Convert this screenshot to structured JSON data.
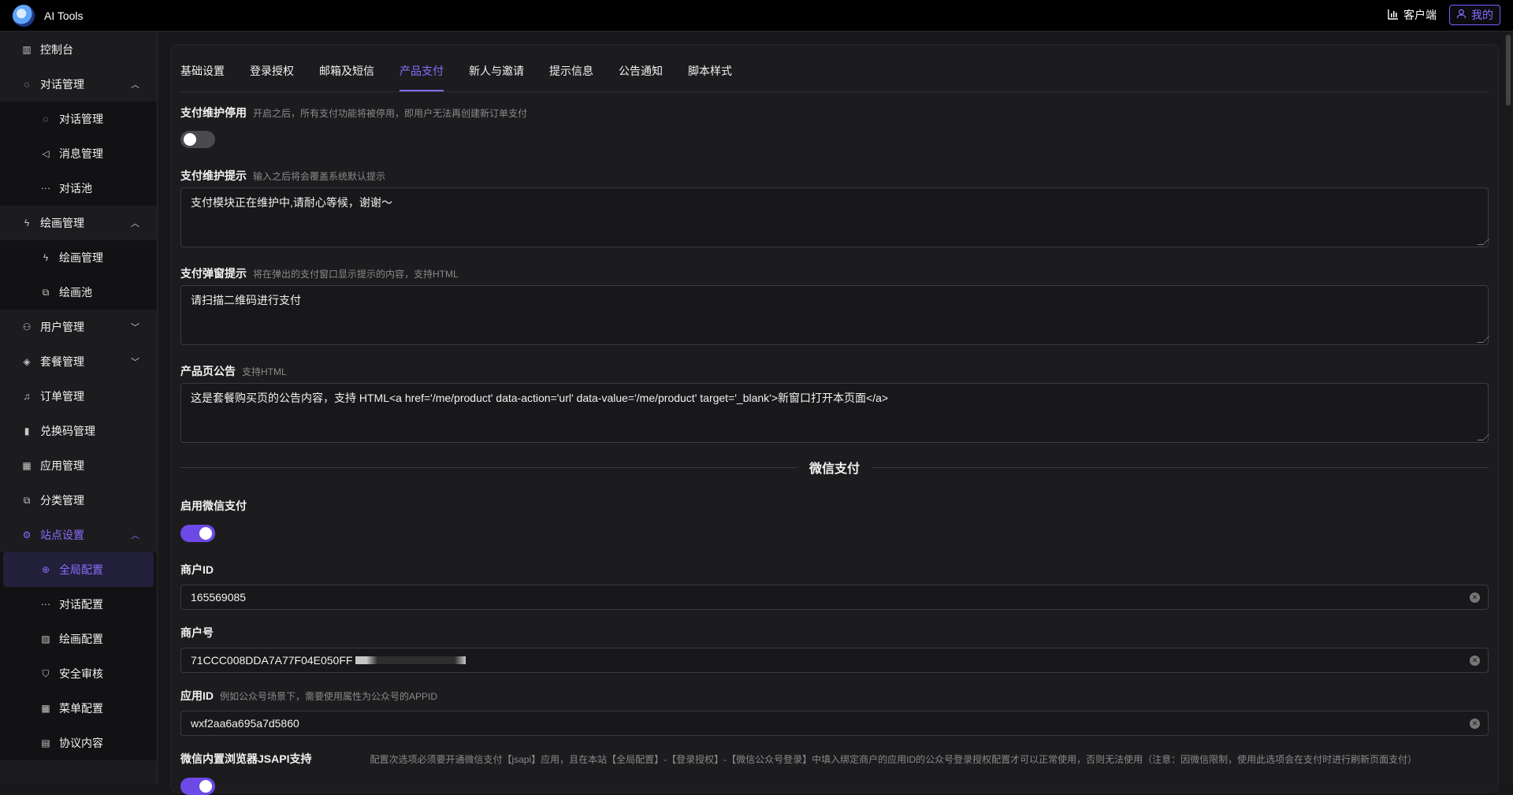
{
  "header": {
    "app_title": "AI Tools",
    "client_label": "客户端",
    "mine_label": "我的"
  },
  "sidebar": {
    "items": [
      {
        "label": "控制台",
        "icon": "chart-icon"
      },
      {
        "label": "对话管理",
        "icon": "chat-icon",
        "expanded": true,
        "children": [
          {
            "label": "对话管理",
            "icon": "chat-icon"
          },
          {
            "label": "消息管理",
            "icon": "megaphone-icon"
          },
          {
            "label": "对话池",
            "icon": "dots-icon"
          }
        ]
      },
      {
        "label": "绘画管理",
        "icon": "bolt-icon",
        "expanded": true,
        "children": [
          {
            "label": "绘画管理",
            "icon": "bolt-icon"
          },
          {
            "label": "绘画池",
            "icon": "copy-icon"
          }
        ]
      },
      {
        "label": "用户管理",
        "icon": "user-icon",
        "expanded": false
      },
      {
        "label": "套餐管理",
        "icon": "diamond-icon",
        "expanded": false
      },
      {
        "label": "订单管理",
        "icon": "bell-icon"
      },
      {
        "label": "兑换码管理",
        "icon": "barcode-icon"
      },
      {
        "label": "应用管理",
        "icon": "grid-icon"
      },
      {
        "label": "分类管理",
        "icon": "copy-icon"
      },
      {
        "label": "站点设置",
        "icon": "gear-icon",
        "expanded": true,
        "children": [
          {
            "label": "全局配置",
            "icon": "globe-icon",
            "active": true
          },
          {
            "label": "对话配置",
            "icon": "dots-icon"
          },
          {
            "label": "绘画配置",
            "icon": "image-icon"
          },
          {
            "label": "安全审核",
            "icon": "shield-icon"
          },
          {
            "label": "菜单配置",
            "icon": "grid-icon"
          },
          {
            "label": "协议内容",
            "icon": "doc-icon"
          }
        ]
      }
    ]
  },
  "tabs": [
    "基础设置",
    "登录授权",
    "邮箱及短信",
    "产品支付",
    "新人与邀请",
    "提示信息",
    "公告通知",
    "脚本样式"
  ],
  "active_tab": "产品支付",
  "form": {
    "maintenance": {
      "label": "支付维护停用",
      "hint": "开启之后，所有支付功能将被停用，即用户无法再创建新订单支付",
      "enabled": false
    },
    "maintenance_tip": {
      "label": "支付维护提示",
      "hint": "输入之后将会覆盖系统默认提示",
      "value": "支付模块正在维护中,请耐心等候，谢谢～"
    },
    "popup_tip": {
      "label": "支付弹窗提示",
      "hint": "将在弹出的支付窗口显示提示的内容，支持HTML",
      "value": "请扫描二维码进行支付"
    },
    "product_notice": {
      "label": "产品页公告",
      "hint": "支持HTML",
      "value": "这是套餐购买页的公告内容，支持 HTML<a href='/me/product' data-action='url' data-value='/me/product' target='_blank'>新窗口打开本页面</a>"
    },
    "wechat_section_title": "微信支付",
    "wechat_enable": {
      "label": "启用微信支付",
      "enabled": true
    },
    "merchant_id": {
      "label": "商户ID",
      "value": "165569085"
    },
    "merchant_key": {
      "label": "商户号",
      "value": "71CCC008DDA7A77F04E050FF"
    },
    "app_id": {
      "label": "应用ID",
      "hint": "例如公众号场景下，需要使用属性为公众号的APPID",
      "value": "wxf2aa6a695a7d5860"
    },
    "jsapi": {
      "label": "微信内置浏览器JSAPI支持",
      "hint": "配置次选项必须要开通微信支付【jsapi】应用，且在本站【全局配置】-【登录授权】-【微信公众号登录】中填入绑定商户的应用ID的公众号登录授权配置才可以正常使用，否则无法使用（注意：因微信限制，使用此选项会在支付时进行刷新页面支付）",
      "enabled": true
    }
  },
  "colors": {
    "accent": "#8b6cff",
    "toggle_on": "#6d4ae6",
    "bg": "#18181b"
  }
}
